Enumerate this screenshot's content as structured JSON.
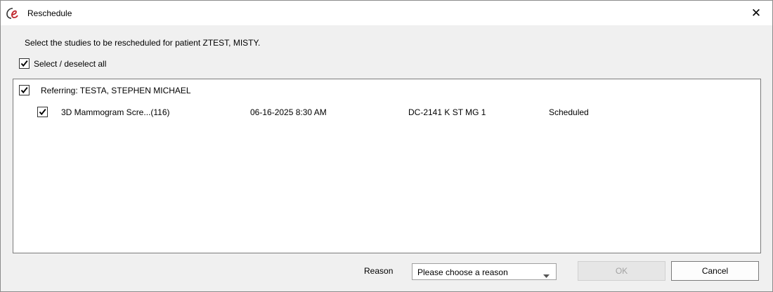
{
  "window": {
    "title": "Reschedule",
    "app_icon": "e-logo-icon",
    "close_icon": "close-icon",
    "close_glyph": "✕"
  },
  "instructions": "Select the studies to be rescheduled for patient ZTEST, MISTY.",
  "select_all": {
    "label": "Select / deselect all",
    "checked": true
  },
  "group": {
    "label": "Referring: TESTA, STEPHEN MICHAEL",
    "checked": true
  },
  "studies": [
    {
      "checked": true,
      "name": "3D Mammogram Scre...(116)",
      "datetime": "06-16-2025 8:30 AM",
      "location": "DC-2141 K ST MG 1",
      "status": "Scheduled"
    }
  ],
  "reason": {
    "label": "Reason",
    "selected": "Please choose a reason"
  },
  "buttons": {
    "ok": "OK",
    "cancel": "Cancel"
  },
  "colors": {
    "logo": "#c0272d",
    "disabled_text": "#a3a3a3"
  }
}
